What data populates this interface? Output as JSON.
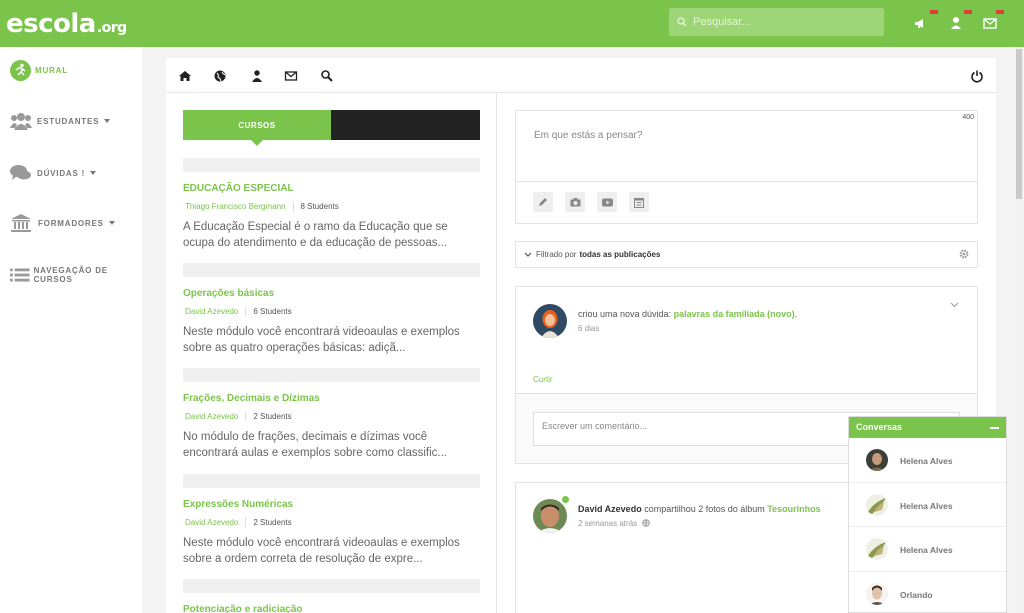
{
  "brand": {
    "name": "escola",
    "tld": ".org"
  },
  "search": {
    "placeholder": "Pesquisar..."
  },
  "sidebar": {
    "items": [
      {
        "label": "MURAL",
        "icon": "runner-icon",
        "active": true
      },
      {
        "label": "ESTUDANTES",
        "icon": "users-icon",
        "dropdown": true
      },
      {
        "label": "DÚVIDAS !",
        "icon": "chat-bubbles-icon",
        "dropdown": true
      },
      {
        "label": "FORMADORES",
        "icon": "institution-icon",
        "dropdown": true
      },
      {
        "label": "NAVEGAÇÃO DE CURSOS",
        "icon": "list-icon"
      }
    ]
  },
  "courses": {
    "tab_label": "CURSOS",
    "items": [
      {
        "title": "EDUCAÇÃO ESPECIAL",
        "author": "Thiago Francisco Bergmann",
        "students": "8 Students",
        "desc": "A Educação Especial é o ramo da Educação que se ocupa do atendimento e da educação de pessoas..."
      },
      {
        "title": "Operações básicas",
        "author": "David Azevedo",
        "students": "6 Students",
        "desc": "Neste módulo você encontrará videoaulas e exemplos sobre as quatro operações básicas: adiçã..."
      },
      {
        "title": "Frações, Decimais e Dízimas",
        "author": "David Azevedo",
        "students": "2 Students",
        "desc": "No módulo de frações, decimais e dízimas você encontrará aulas e exemplos sobre como classific..."
      },
      {
        "title": "Expressões Numéricas",
        "author": "David Azevedo",
        "students": "2 Students",
        "desc": "Neste módulo você encontrará videoaulas e exemplos sobre a ordem correta de resolução de expre..."
      },
      {
        "title": "Potenciação e radiciação",
        "author": "",
        "students": "",
        "desc": ""
      }
    ]
  },
  "composer": {
    "placeholder": "Em que estás a pensar?",
    "char_limit": "400"
  },
  "filter": {
    "prefix": "Filtrado por",
    "value": "todas as publicações"
  },
  "posts": [
    {
      "actor": "",
      "action": "criou uma nova dúvida:",
      "target": "palavras da familiada (novo)",
      "suffix": ".",
      "time": "6 dias",
      "like": "Curtir",
      "comment_placeholder": "Escrever um comentário..."
    },
    {
      "actor": "David Azevedo",
      "action": "compartilhou 2 fotos do álbum",
      "target": "Tesourinhos",
      "time": "2 semanas atrás"
    }
  ],
  "chat": {
    "title": "Conversas",
    "contacts": [
      {
        "name": "Helena Alves"
      },
      {
        "name": "Helena Alves"
      },
      {
        "name": "Helena Alves"
      },
      {
        "name": "Orlando"
      }
    ]
  },
  "colors": {
    "accent": "#7bc44b",
    "dark": "#222222",
    "badge": "#e23c3c"
  }
}
